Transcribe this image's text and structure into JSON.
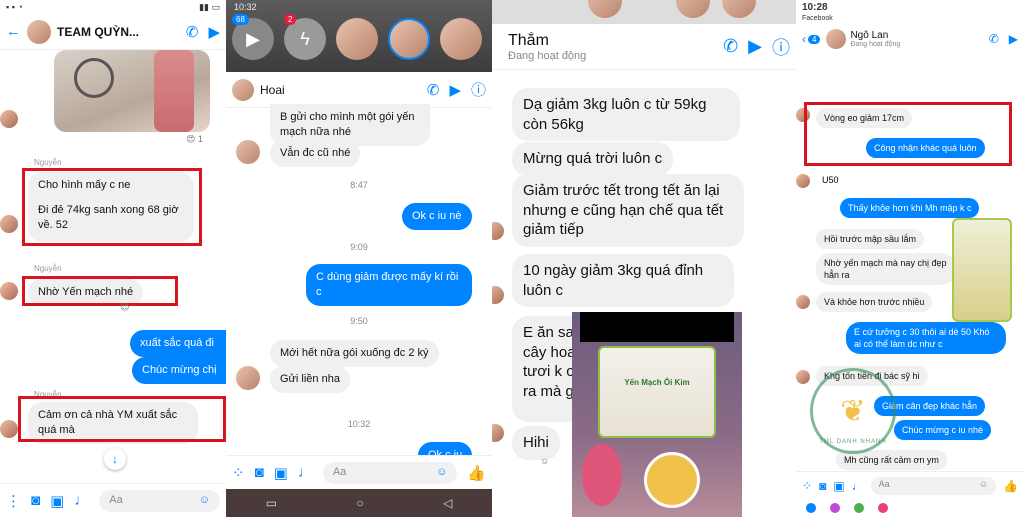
{
  "panel1": {
    "header": {
      "name": "TEAM QUỲN..."
    },
    "sender_label_1": "Nguyễn",
    "sender_label_2": "Nguyễn",
    "sender_label_3": "Nguyễn",
    "messages": {
      "m1": "Cho hình mấy c ne",
      "m2": "Đi đẻ 74kg sanh xong 68 giờ về. 52",
      "m3": "Nhờ Yến mạch nhé",
      "m4": "xuất sắc quá đi",
      "m5": "Chúc mừng chị",
      "m6": "Cảm ơn cả nhà YM xuất sắc quá mà"
    },
    "reaction_count": "1",
    "composer_placeholder": "Aa"
  },
  "panel2": {
    "status_time": "10:32",
    "story_badge_1": "68",
    "story_badge_2": "2",
    "header": {
      "name": "Hoai"
    },
    "messages": {
      "m1": "B gửi cho mình một gói yến mạch nữa nhé",
      "m2": "Vẫn đc cũ nhé",
      "m3": "Ok c iu nè",
      "m4": "C dùng giảm được mấy kí rồi c",
      "m5": "Mới hết nữa gói xuống đc 2 ký",
      "m6": "Gửi liền nha",
      "m7": "Ok c iu"
    },
    "times": {
      "t1": "8:47",
      "t2": "9:09",
      "t3": "9:50",
      "t4": "10:32"
    },
    "composer_placeholder": "Aa"
  },
  "panel3": {
    "header": {
      "name": "Thắm",
      "status": "Đang hoạt động"
    },
    "messages": {
      "m1": "Dạ giảm 3kg luôn c từ 59kg còn 56kg",
      "m2": "Mừng quá trời luôn c",
      "m3": "Giảm trước tết trong tết ăn lại nhưng e cũng hạn chế qua tết giảm tiếp",
      "m4": "10 ngày giảm 3kg quá đỉnh luôn c",
      "m5": "E ăn sa cây hoa tươi k canh ra mà giả",
      "m6": "Hihi"
    },
    "product_label": "Yến Mạch Ôi Kim"
  },
  "panel4": {
    "status_time": "10:28",
    "status_app": "Facebook",
    "header": {
      "name": "Ngô Lan",
      "status": "Đang hoạt động"
    },
    "badge": "4",
    "messages": {
      "m1": "Vòng eo giảm 17cm",
      "m2": "Công nhận khác quá luôn",
      "m3": "U50",
      "m4": "Thấy khỏe hơn khi Mh mập k c",
      "m5": "Hồi trước mập sầu lắm",
      "m6": "Nhờ yến mạch mà nay chị đẹp hẳn ra",
      "m7": "Và khỏe hơn trước nhiều",
      "m8": "E cứ tưởng c 30 thôi ai dè 50 Khó ai có thể làm dc như c",
      "m9": "Khg tốn tiền đi bác sỹ hi",
      "m10": "Giảm cân đẹp khác hẳn",
      "m11": "Chúc mừng c iu nhé",
      "m12": "Mh cũng rất cảm ơn ym"
    },
    "watermark": "TML DANH NHANH",
    "composer_placeholder": "Aa"
  },
  "colors": {
    "messenger_blue": "#0084ff",
    "highlight_red": "#d9141f",
    "incoming_gray": "#f0f0f0"
  }
}
